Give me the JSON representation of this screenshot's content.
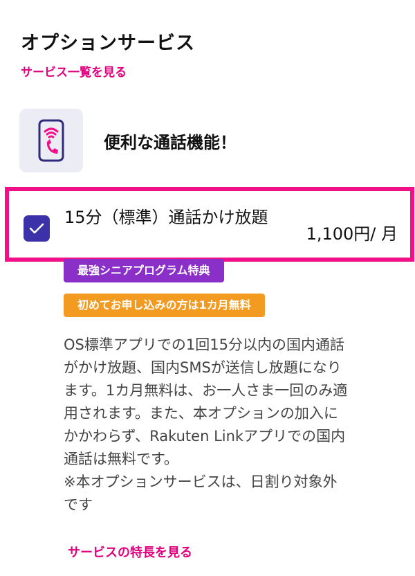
{
  "header": {
    "title": "オプションサービス",
    "list_link": "サービス一覧を見る"
  },
  "feature": {
    "icon": "phone-call-icon",
    "title": "便利な通話機能！"
  },
  "option": {
    "checked": true,
    "name": "15分（標準）通話かけ放題",
    "price": "1,100円/ 月"
  },
  "badges": [
    {
      "label": "最強シニアプログラム特典",
      "color": "#8a30c8"
    },
    {
      "label": "初めてお申し込みの方は1カ月無料",
      "color": "#f39a21"
    }
  ],
  "description": {
    "lines": [
      "OS標準アプリでの1回15分以内の国内通話",
      "がかけ放題、国内SMSが送信し放題になり",
      "ます。1カ月無料は、お一人さま一回のみ適",
      "用されます。また、本オプションの加入に",
      "かかわらず、Rakuten Linkアプリでの国内",
      "通話は無料です。",
      "※本オプションサービスは、日割り対象外",
      "です"
    ]
  },
  "details_link": "サービスの特長を見る",
  "colors": {
    "accent": "#e0007e",
    "highlight_border": "#f20f8a",
    "checkbox": "#3b31a8"
  }
}
